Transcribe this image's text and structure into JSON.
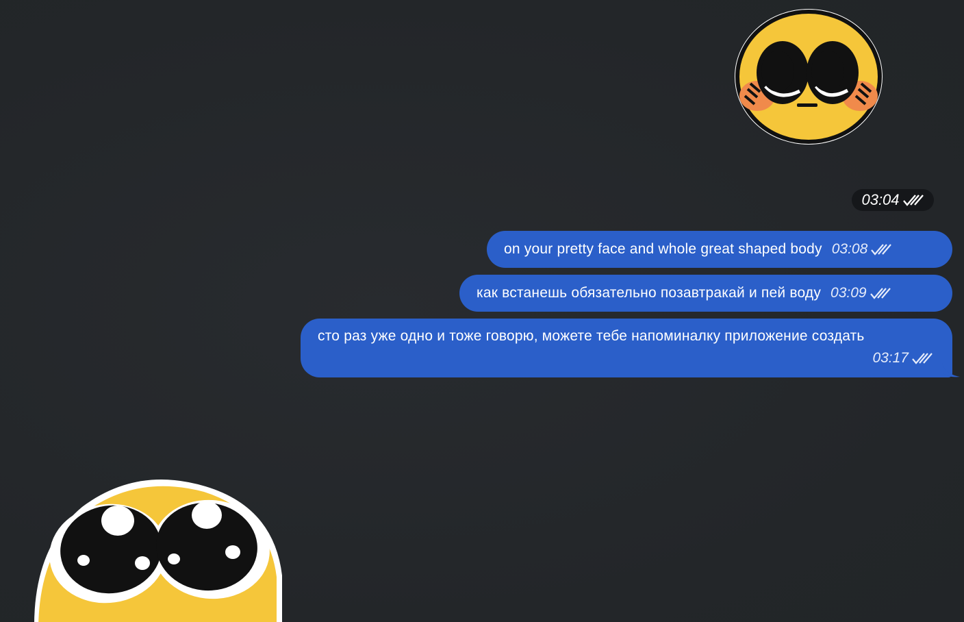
{
  "header_time": {
    "time": "03:04"
  },
  "messages": [
    {
      "text": "on your pretty face and whole great shaped body",
      "time": "03:08"
    },
    {
      "text": "как встанешь обязательно позавтракай и пей воду",
      "time": "03:09"
    },
    {
      "text": "сто раз уже одно и тоже говорю, можете тебе напоминалку приложение создать",
      "time": "03:17"
    }
  ],
  "colors": {
    "background": "#24272b",
    "outgoing_bubble": "#2b5fc9",
    "time_pill": "#15171a",
    "sticker_yellow": "#f5c63a",
    "sticker_blush": "#f08a4b"
  },
  "icons": {
    "read_receipt": "double-check-icon",
    "top_sticker": "pleading-face-sticker",
    "bottom_sticker": "big-eyes-face-sticker"
  }
}
